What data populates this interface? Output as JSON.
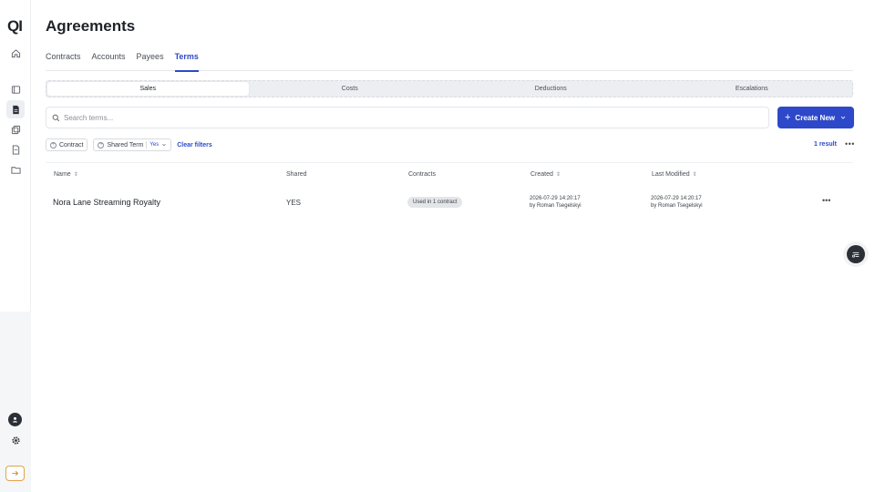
{
  "app": {
    "logo": "QI"
  },
  "sidebar": {
    "icons": [
      "home-icon",
      "book-icon",
      "document-icon",
      "copy-icon",
      "file-icon",
      "folder-icon"
    ],
    "bottom_icons": [
      "user-icon",
      "gear-icon",
      "arrow-right-icon"
    ]
  },
  "header": {
    "title": "Agreements"
  },
  "tabs": [
    {
      "label": "Contracts"
    },
    {
      "label": "Accounts"
    },
    {
      "label": "Payees"
    },
    {
      "label": "Terms"
    }
  ],
  "active_tab": "Terms",
  "segments": [
    {
      "label": "Sales"
    },
    {
      "label": "Costs"
    },
    {
      "label": "Deductions"
    },
    {
      "label": "Escalations"
    }
  ],
  "active_segment": "Sales",
  "search": {
    "placeholder": "Search terms...",
    "value": ""
  },
  "create_button": {
    "label": "Create New"
  },
  "filters": {
    "contract_label": "Contract",
    "shared_term_label": "Shared Term",
    "shared_term_value": "Yes",
    "clear_label": "Clear filters",
    "result_count": "1 result"
  },
  "table": {
    "columns": [
      "Name",
      "Shared",
      "Contracts",
      "Created",
      "Last Modified"
    ],
    "rows": [
      {
        "name": "Nora Lane Streaming Royalty",
        "shared": "YES",
        "contracts": "Used in 1 contract",
        "created_date": "2026-07-29 14:20:17",
        "created_by": "by Roman Tsegelskyi",
        "modified_date": "2026-07-29 14:20:17",
        "modified_by": "by Roman Tsegelskyi"
      }
    ]
  },
  "colors": {
    "accent": "#2d49c9",
    "sidebar_bottom": "#f5f6f8",
    "badge_bg": "#e3e5e8"
  }
}
